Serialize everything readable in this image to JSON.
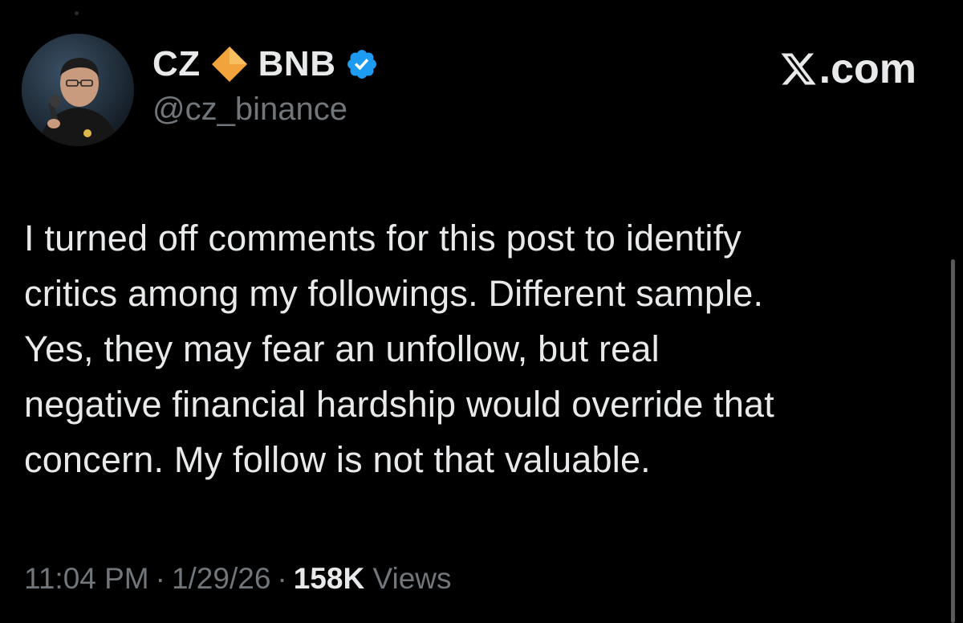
{
  "post": {
    "author": {
      "display_name": "CZ",
      "display_name_suffix": "BNB",
      "handle": "@cz_binance",
      "avatar_icon": "person-with-microphone-avatar",
      "diamond_icon": "orange-diamond-icon",
      "diamond_color": "#f3a33b",
      "verified_icon": "verified-badge-icon",
      "verified_color": "#1d9bf0"
    },
    "site_label": "com",
    "site_logo_icon": "x-logo-icon",
    "text_lines": [
      "I turned off comments for this post to identify",
      "critics among my followings. Different sample.",
      "Yes, they may fear an unfollow, but real",
      "negative financial hardship would override that",
      "concern. My follow is not that valuable."
    ],
    "meta": {
      "time": "11:04 PM",
      "separator": "·",
      "date": "1/29/26",
      "views_count": "158K",
      "views_label": "Views"
    }
  },
  "colors": {
    "background": "#000000",
    "primary_text": "#e7e9ea",
    "secondary_text": "#71767b"
  }
}
